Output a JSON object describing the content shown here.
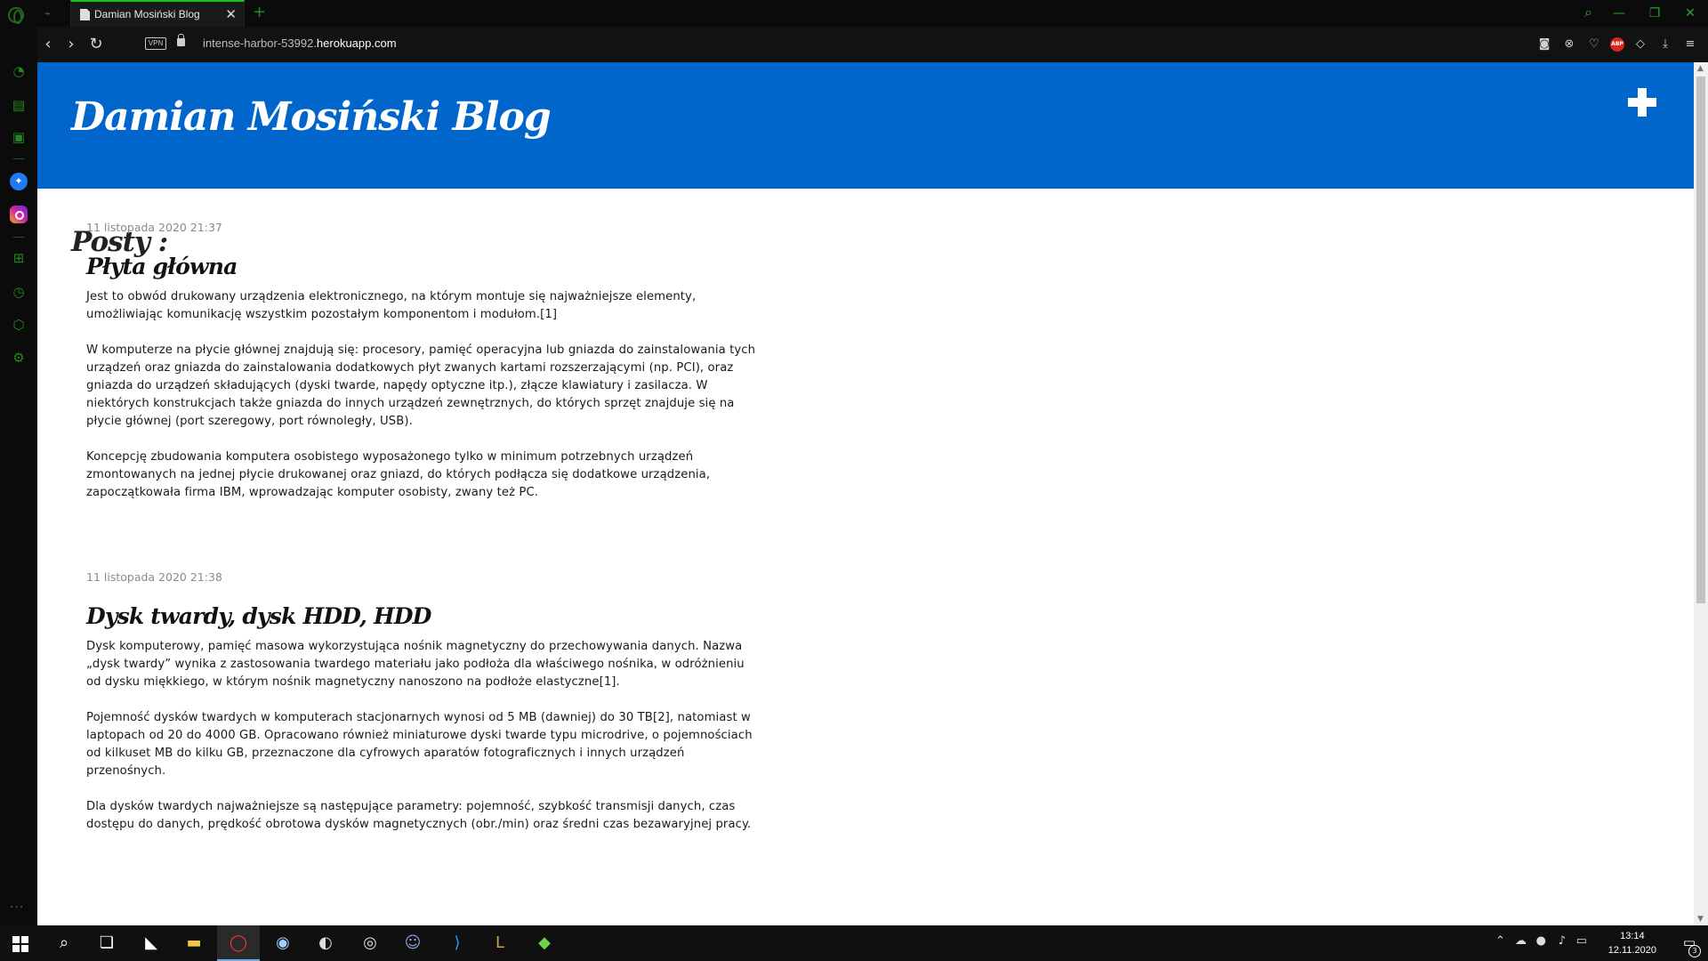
{
  "browser": {
    "tab": {
      "title": "Damian Mosiński Blog",
      "close": "✕"
    },
    "new_tab": "+",
    "url_prefix": "intense-harbor-53992.",
    "url_host": "herokuapp.com",
    "vpn_label": "VPN",
    "abp_label": "ABP"
  },
  "site": {
    "title": "Damian Mosiński Blog",
    "posts_heading": "Posty :"
  },
  "posts": [
    {
      "date": "11 listopada 2020 21:37",
      "title": "Płyta główna",
      "paragraphs": [
        "Jest to obwód drukowany urządzenia elektronicznego, na którym montuje się najważniejsze elementy, umożliwiając komunikację wszystkim pozostałym komponentom i modułom.[1]",
        "W komputerze na płycie głównej znajdują się: procesory, pamięć operacyjna lub gniazda do zainstalowania tych urządzeń oraz gniazda do zainstalowania dodatkowych płyt zwanych kartami rozszerzającymi (np. PCI), oraz gniazda do urządzeń składujących (dyski twarde, napędy optyczne itp.), złącze klawiatury i zasilacza. W niektórych konstrukcjach także gniazda do innych urządzeń zewnętrznych, do których sprzęt znajduje się na płycie głównej (port szeregowy, port równoległy, USB).",
        "Koncepcję zbudowania komputera osobistego wyposażonego tylko w minimum potrzebnych urządzeń zmontowanych na jednej płycie drukowanej oraz gniazd, do których podłącza się dodatkowe urządzenia, zapoczątkowała firma IBM, wprowadzając komputer osobisty, zwany też PC."
      ]
    },
    {
      "date": "11 listopada 2020 21:38",
      "title": "Dysk twardy, dysk HDD, HDD",
      "paragraphs": [
        "Dysk komputerowy, pamięć masowa wykorzystująca nośnik magnetyczny do przechowywania danych. Nazwa „dysk twardy” wynika z zastosowania twardego materiału jako podłoża dla właściwego nośnika, w odróżnieniu od dysku miękkiego, w którym nośnik magnetyczny nanoszono na podłoże elastyczne[1].",
        "Pojemność dysków twardych w komputerach stacjonarnych wynosi od 5 MB (dawniej) do 30 TB[2], natomiast w laptopach od 20 do 4000 GB. Opracowano również miniaturowe dyski twarde typu microdrive, o pojemnościach od kilkuset MB do kilku GB, przeznaczone dla cyfrowych aparatów fotograficznych i innych urządzeń przenośnych.",
        "Dla dysków twardych najważniejsze są następujące parametry: pojemność, szybkość transmisji danych, czas dostępu do danych, prędkość obrotowa dysków magnetycznych (obr./min) oraz średni czas bezawaryjnej pracy."
      ]
    }
  ],
  "taskbar": {
    "time": "13:14",
    "date": "12.11.2020",
    "notification_count": "3"
  },
  "colors": {
    "header_bg": "#0066cc",
    "accent_green": "#19c219"
  }
}
